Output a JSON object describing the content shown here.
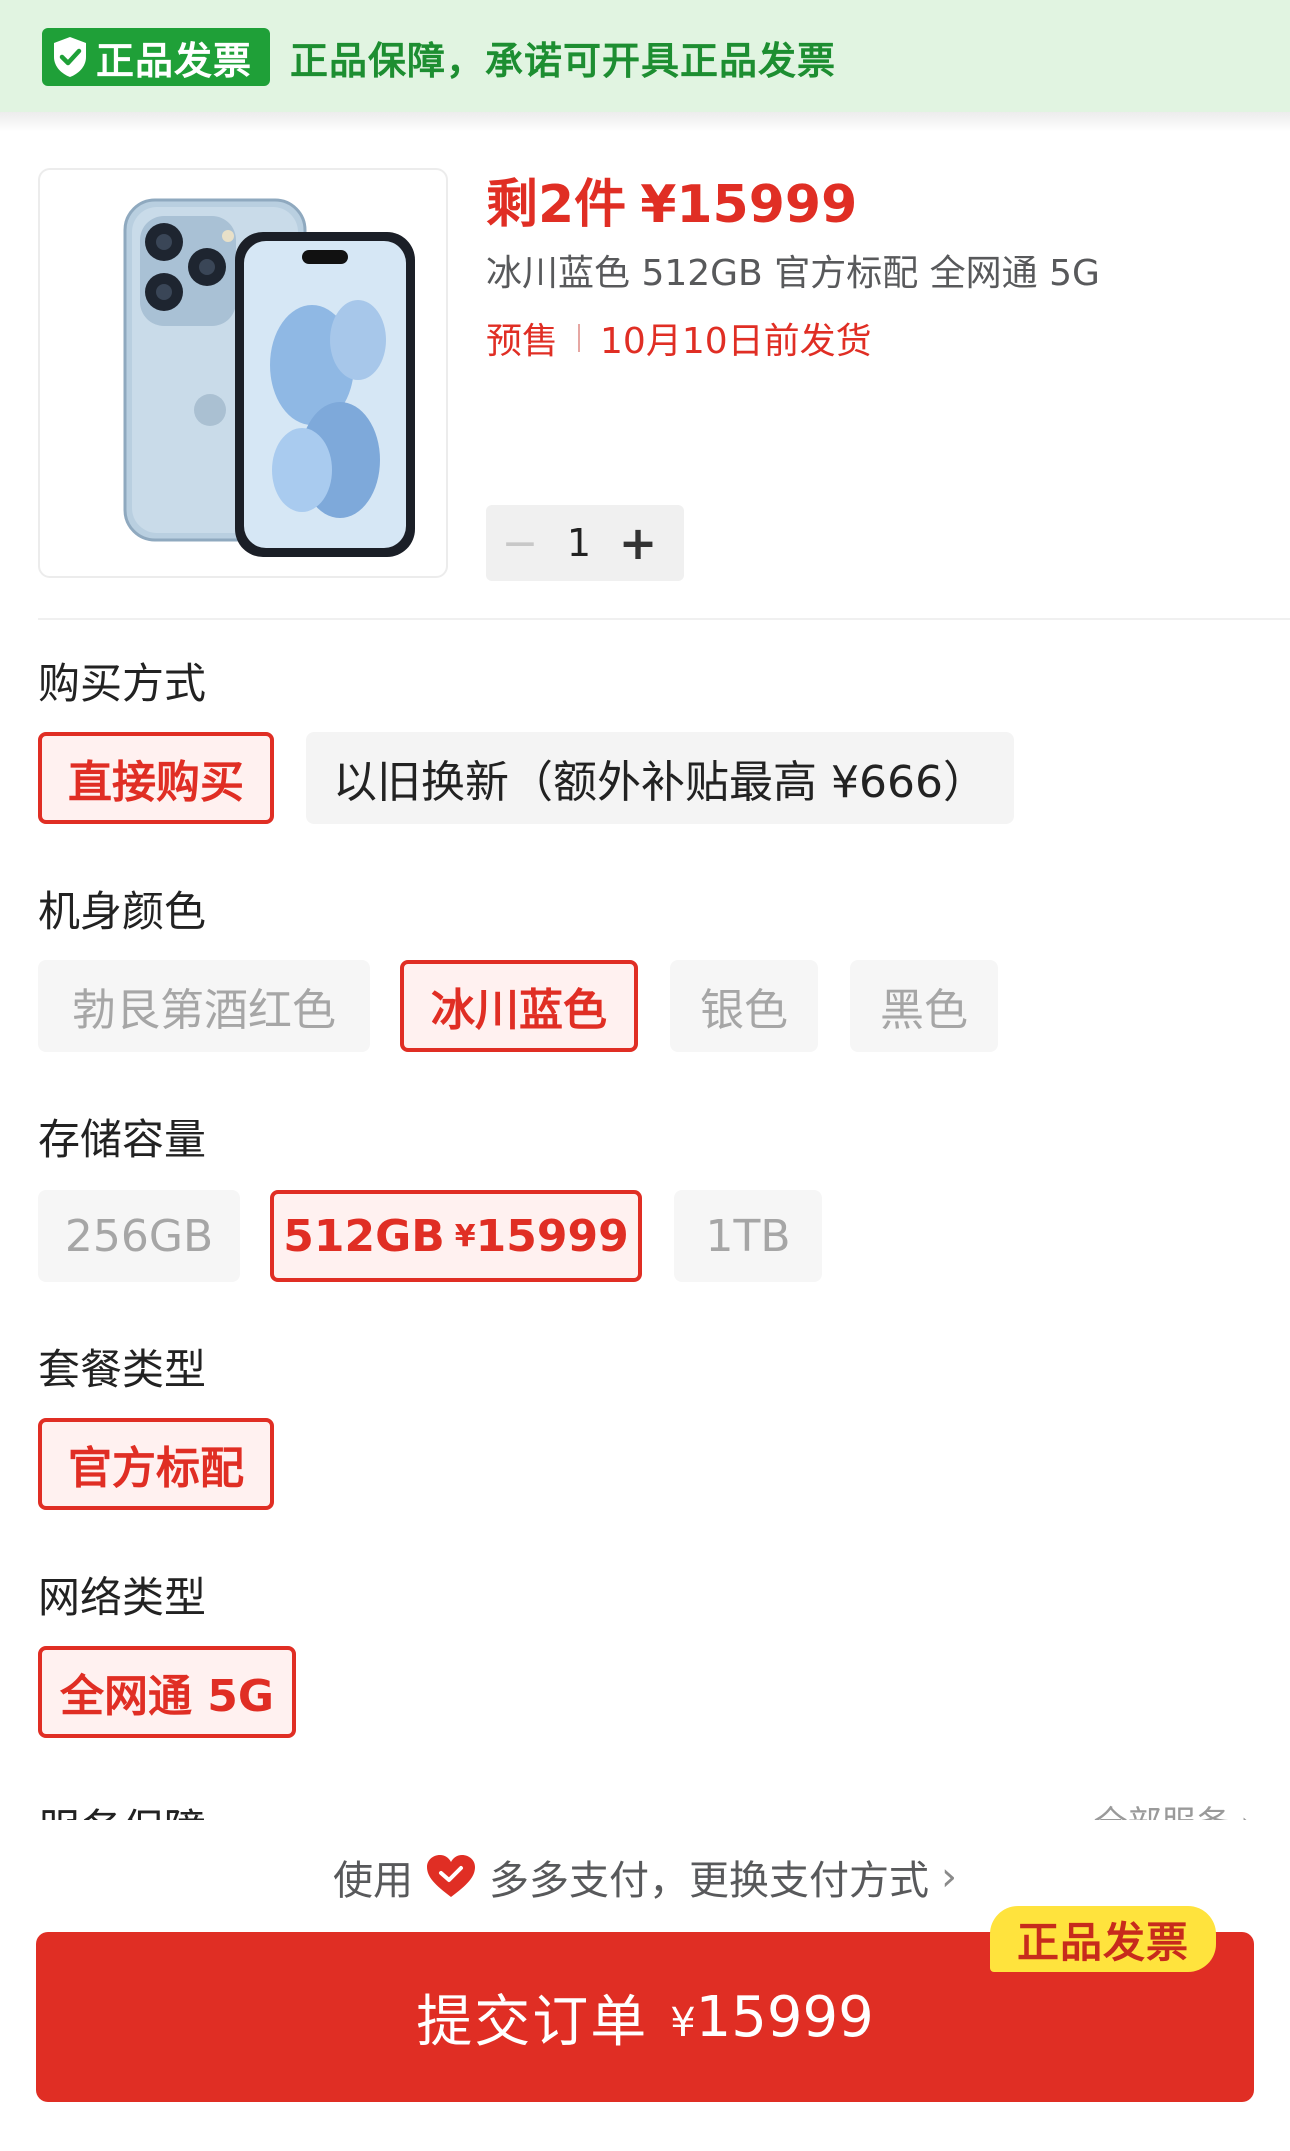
{
  "banner": {
    "badge_label": "正品发票",
    "text": "正品保障，承诺可开具正品发票"
  },
  "product": {
    "stock_text": "剩2件",
    "price": "¥15999",
    "spec": "冰川蓝色 512GB 官方标配 全网通 5G",
    "presale_label": "预售",
    "ship_text": "10月10日前发货",
    "quantity": "1",
    "image_alt": "phone-product-image"
  },
  "sections": {
    "purchase_method": {
      "title": "购买方式",
      "options": [
        "直接购买",
        "以旧换新（额外补贴最高 ¥666）"
      ]
    },
    "color": {
      "title": "机身颜色",
      "options": [
        "勃艮第酒红色",
        "冰川蓝色",
        "银色",
        "黑色"
      ]
    },
    "storage": {
      "title": "存储容量",
      "options": [
        "256GB",
        "512GB",
        "1TB"
      ],
      "selected_price": "15999"
    },
    "package": {
      "title": "套餐类型",
      "options": [
        "官方标配"
      ]
    },
    "network": {
      "title": "网络类型",
      "options": [
        "全网通 5G"
      ]
    },
    "service": {
      "title": "服务保障",
      "more": "全部服务 ›"
    }
  },
  "payment": {
    "prefix": "使用",
    "method": "多多支付，更换支付方式",
    "chevron": "›"
  },
  "submit": {
    "label": "提交订单",
    "yen": "¥",
    "amount": "15999",
    "tag": "正品发票"
  },
  "colors": {
    "accent_red": "#e02e24",
    "banner_green": "#1fa038",
    "banner_bg": "#e1f4e1",
    "tag_yellow": "#ffe33d"
  }
}
